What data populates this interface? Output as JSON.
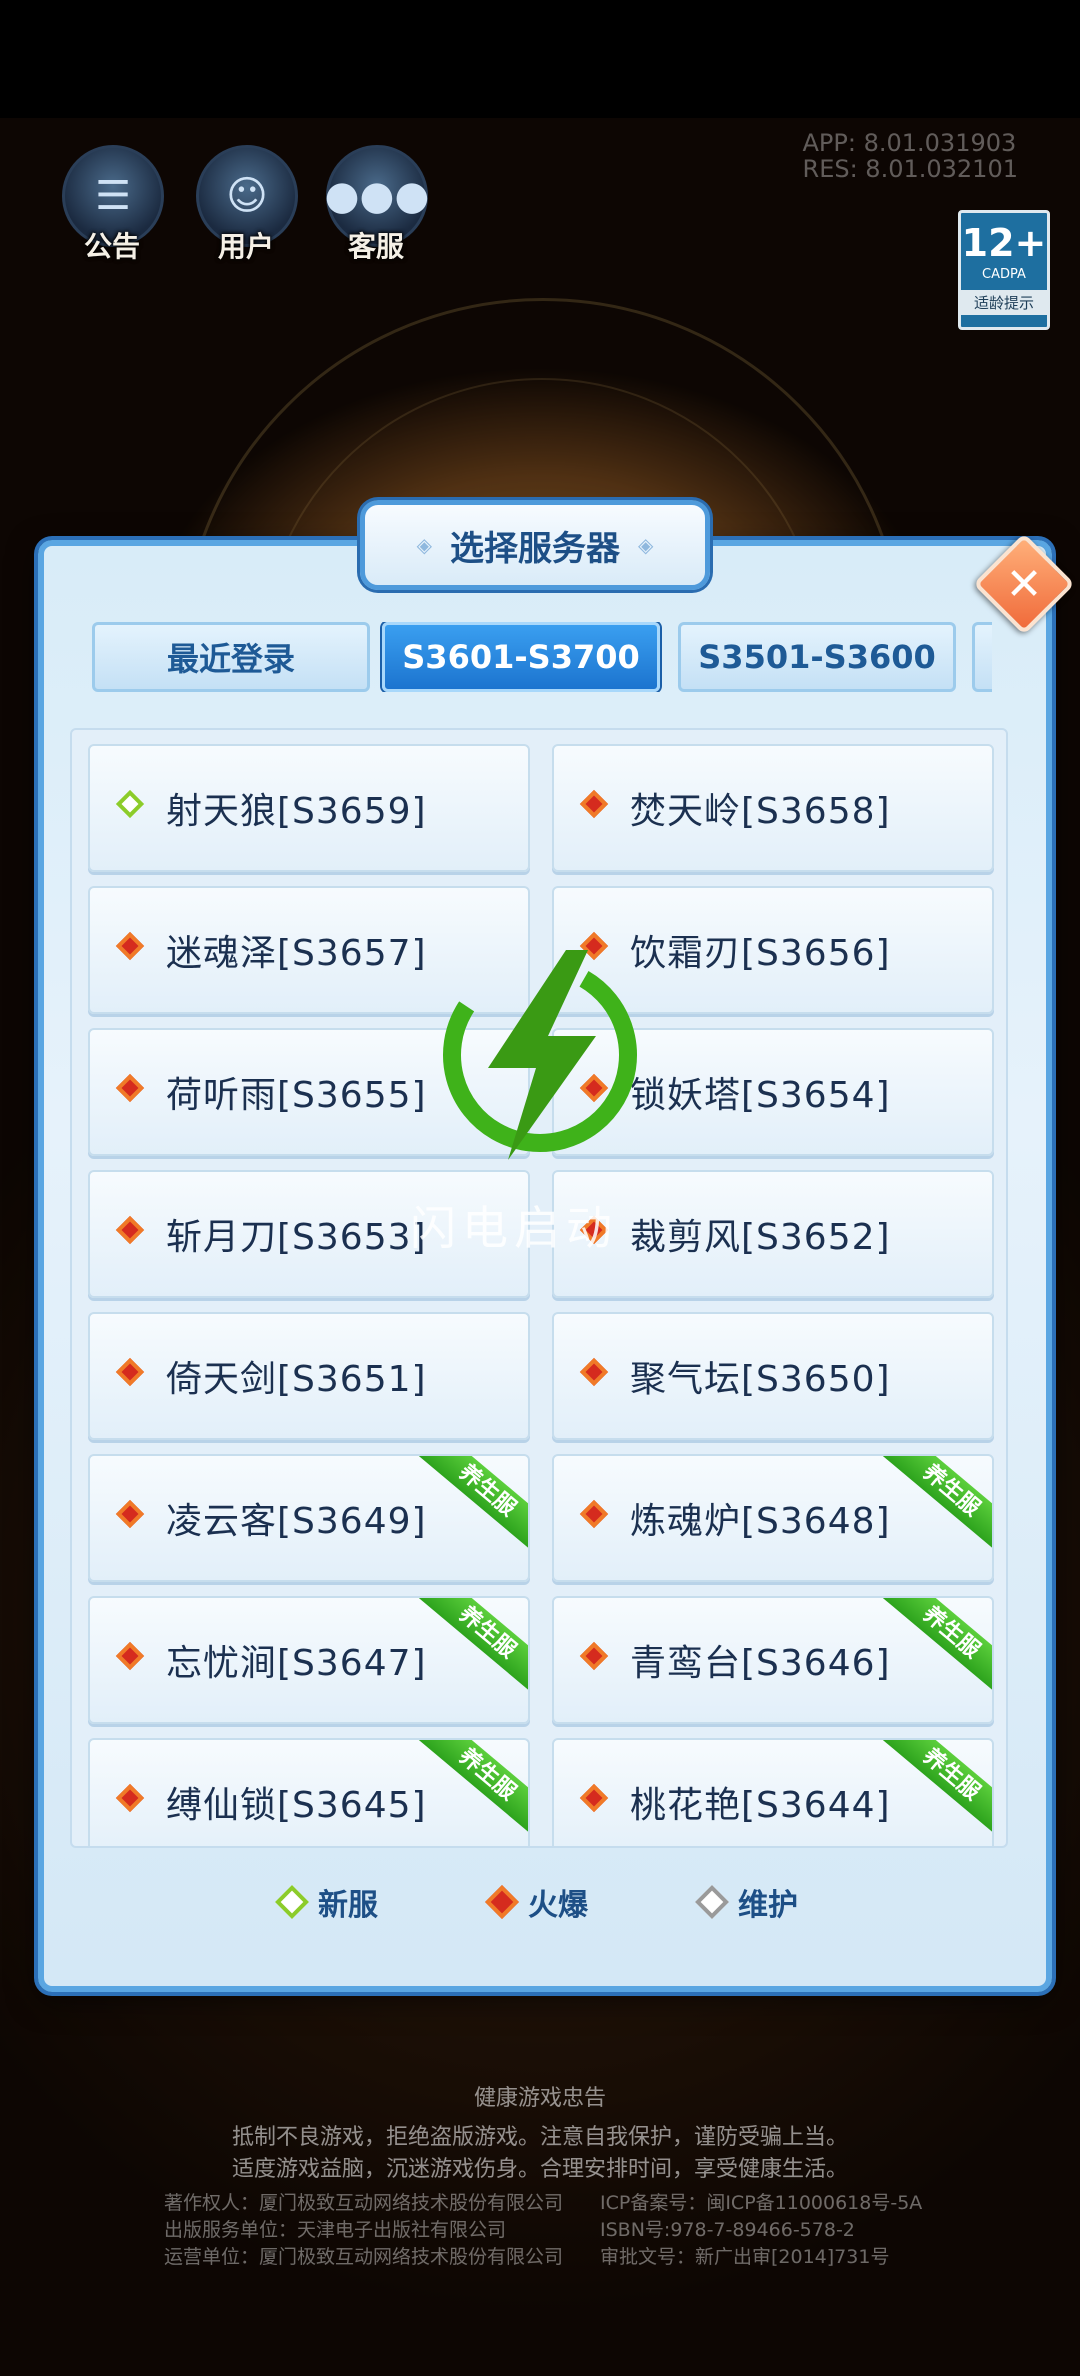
{
  "top_icons": [
    {
      "name": "notice",
      "label": "公告"
    },
    {
      "name": "user",
      "label": "用户"
    },
    {
      "name": "service",
      "label": "客服"
    }
  ],
  "version": {
    "app": "APP:   8.01.031903",
    "res": "RES:   8.01.032101"
  },
  "age_badge": {
    "rating": "12+",
    "org": "CADPA",
    "tip": "适龄提示"
  },
  "dialog": {
    "title": "选择服务器",
    "tabs": [
      {
        "label": "最近登录",
        "active": false
      },
      {
        "label": "S3601-S3700",
        "active": true
      },
      {
        "label": "S3501-S3600",
        "active": false
      }
    ],
    "servers": [
      {
        "name": "射天狼[S3659]",
        "status": "new",
        "tag": ""
      },
      {
        "name": "焚天岭[S3658]",
        "status": "hot",
        "tag": ""
      },
      {
        "name": "迷魂泽[S3657]",
        "status": "hot",
        "tag": ""
      },
      {
        "name": "饮霜刃[S3656]",
        "status": "hot",
        "tag": ""
      },
      {
        "name": "荷听雨[S3655]",
        "status": "hot",
        "tag": ""
      },
      {
        "name": "锁妖塔[S3654]",
        "status": "hot",
        "tag": ""
      },
      {
        "name": "斩月刀[S3653]",
        "status": "hot",
        "tag": ""
      },
      {
        "name": "裁剪风[S3652]",
        "status": "hot",
        "tag": ""
      },
      {
        "name": "倚天剑[S3651]",
        "status": "hot",
        "tag": ""
      },
      {
        "name": "聚气坛[S3650]",
        "status": "hot",
        "tag": ""
      },
      {
        "name": "凌云客[S3649]",
        "status": "hot",
        "tag": "养生服"
      },
      {
        "name": "炼魂炉[S3648]",
        "status": "hot",
        "tag": "养生服"
      },
      {
        "name": "忘忧涧[S3647]",
        "status": "hot",
        "tag": "养生服"
      },
      {
        "name": "青鸾台[S3646]",
        "status": "hot",
        "tag": "养生服"
      },
      {
        "name": "缚仙锁[S3645]",
        "status": "hot",
        "tag": "养生服"
      },
      {
        "name": "桃花艳[S3644]",
        "status": "hot",
        "tag": "养生服"
      }
    ],
    "legend": [
      {
        "label": "新服",
        "color": "#8ccc2a"
      },
      {
        "label": "火爆",
        "color": "#f07a28"
      },
      {
        "label": "维护",
        "color": "#9a9a9a"
      }
    ],
    "close_icon": "close-icon"
  },
  "watermark": {
    "text": "闪电启动"
  },
  "footer": {
    "heading": "健康游戏忠告",
    "line1": "抵制不良游戏，拒绝盗版游戏。注意自我保护，谨防受骗上当。",
    "line2": "适度游戏益脑，沉迷游戏伤身。合理安排时间，享受健康生活。",
    "left": [
      "著作权人：厦门极致互动网络技术股份有限公司",
      "出版服务单位：天津电子出版社有限公司",
      "运营单位：厦门极致互动网络技术股份有限公司"
    ],
    "right": [
      "ICP备案号：闽ICP备11000618号-5A",
      "ISBN号:978-7-89466-578-2",
      "审批文号：新广出审[2014]731号"
    ]
  },
  "colors": {
    "hot": "#f07a28",
    "new": "#8ccc2a",
    "accent": "#1c74cf"
  }
}
